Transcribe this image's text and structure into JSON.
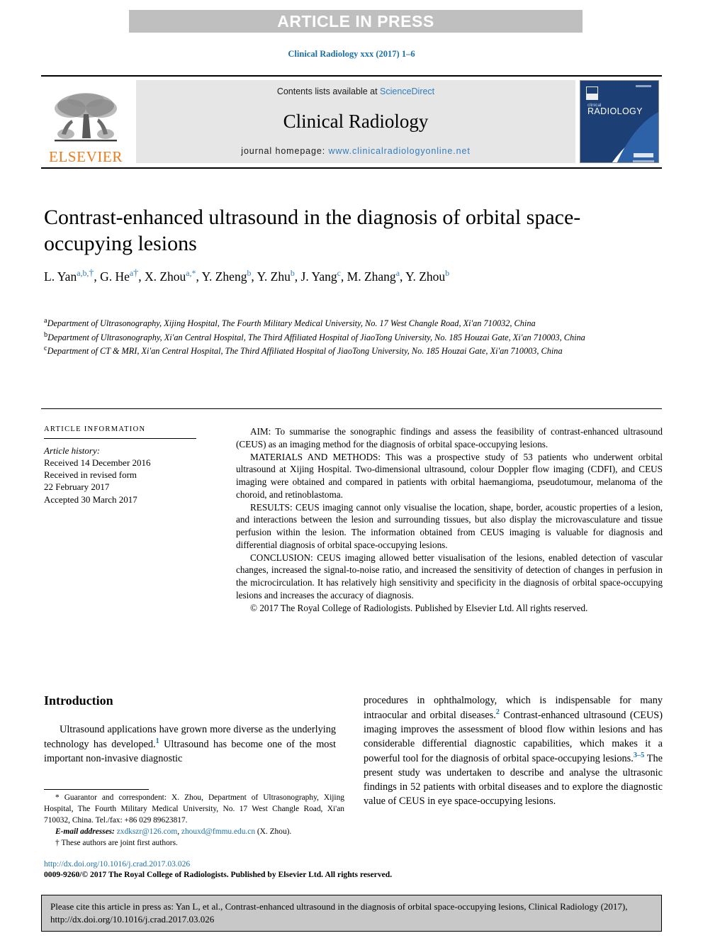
{
  "banner": {
    "text": "ARTICLE IN PRESS"
  },
  "journal_ref": "Clinical Radiology xxx (2017) 1–6",
  "masthead": {
    "publisher_name": "ELSEVIER",
    "contents_prefix": "Contents lists available at ",
    "contents_link": "ScienceDirect",
    "journal_title": "Clinical Radiology",
    "homepage_prefix": "journal homepage: ",
    "homepage_link": "www.clinicalradiologyonline.net",
    "cover_line1": "clinical",
    "cover_line2": "RADIOLOGY"
  },
  "article": {
    "title": "Contrast-enhanced ultrasound in the diagnosis of orbital space-occupying lesions",
    "authors": [
      {
        "name": "L. Yan",
        "sup": "a,b,",
        "dagger": true,
        "tail": ", "
      },
      {
        "name": "G. He",
        "sup": "a",
        "dagger": true,
        "tail": ", "
      },
      {
        "name": "X. Zhou",
        "sup": "a,",
        "star": true,
        "tail": ", "
      },
      {
        "name": "Y. Zheng",
        "sup": "b",
        "tail": ", "
      },
      {
        "name": "Y. Zhu",
        "sup": "b",
        "tail": ", "
      },
      {
        "name": "J. Yang",
        "sup": "c",
        "tail": ", "
      },
      {
        "name": "M. Zhang",
        "sup": "a",
        "tail": ", "
      },
      {
        "name": "Y. Zhou",
        "sup": "b",
        "tail": ""
      }
    ],
    "affiliations": [
      {
        "mark": "a",
        "text": "Department of Ultrasonography, Xijing Hospital, The Fourth Military Medical University, No. 17 West Changle Road, Xi'an 710032, China"
      },
      {
        "mark": "b",
        "text": "Department of Ultrasonography, Xi'an Central Hospital, The Third Affiliated Hospital of JiaoTong University, No. 185 Houzai Gate, Xi'an 710003, China"
      },
      {
        "mark": "c",
        "text": "Department of CT & MRI, Xi'an Central Hospital, The Third Affiliated Hospital of JiaoTong University, No. 185 Houzai Gate, Xi'an 710003, China"
      }
    ]
  },
  "article_info": {
    "heading": "ARTICLE INFORMATION",
    "history_label": "Article history:",
    "received": "Received 14 December 2016",
    "revised_label": "Received in revised form",
    "revised_date": "22 February 2017",
    "accepted": "Accepted 30 March 2017"
  },
  "abstract": {
    "aim": "AIM: To summarise the sonographic findings and assess the feasibility of contrast-enhanced ultrasound (CEUS) as an imaging method for the diagnosis of orbital space-occupying lesions.",
    "materials": "MATERIALS AND METHODS: This was a prospective study of 53 patients who underwent orbital ultrasound at Xijing Hospital. Two-dimensional ultrasound, colour Doppler flow imaging (CDFI), and CEUS imaging were obtained and compared in patients with orbital haemangioma, pseudotumour, melanoma of the choroid, and retinoblastoma.",
    "results": "RESULTS: CEUS imaging cannot only visualise the location, shape, border, acoustic properties of a lesion, and interactions between the lesion and surrounding tissues, but also display the microvasculature and tissue perfusion within the lesion. The information obtained from CEUS imaging is valuable for diagnosis and differential diagnosis of orbital space-occupying lesions.",
    "conclusion": "CONCLUSION: CEUS imaging allowed better visualisation of the lesions, enabled detection of vascular changes, increased the signal-to-noise ratio, and increased the sensitivity of detection of changes in perfusion in the microcirculation. It has relatively high sensitivity and specificity in the diagnosis of orbital space-occupying lesions and increases the accuracy of diagnosis.",
    "copyright": "© 2017 The Royal College of Radiologists. Published by Elsevier Ltd. All rights reserved."
  },
  "body": {
    "section_heading": "Introduction",
    "left_col_part1": "Ultrasound applications have grown more diverse as the underlying technology has developed.",
    "left_ref1": "1",
    "left_col_part2": " Ultrasound has become one of the most important non-invasive diagnostic",
    "right_col_part1": "procedures in ophthalmology, which is indispensable for many intraocular and orbital diseases.",
    "right_ref2": "2",
    "right_col_part2": " Contrast-enhanced ultrasound (CEUS) imaging improves the assessment of blood flow within lesions and has considerable differential diagnostic capabilities, which makes it a powerful tool for the diagnosis of orbital space-occupying lesions.",
    "right_ref35": "3–5",
    "right_col_part3": " The present study was undertaken to describe and analyse the ultrasonic findings in 52 patients with orbital diseases and to explore the diagnostic value of CEUS in eye space-occupying lesions."
  },
  "footnotes": {
    "star_symbol": "*",
    "correspondence": "Guarantor and correspondent: X. Zhou, Department of Ultrasonography, Xijing Hospital, The Fourth Military Medical University, No. 17 West Changle Road, Xi'an 710032, China. Tel./fax: +86 029 89623817.",
    "email_label": "E-mail addresses:",
    "email1": "zxdkszr@126.com",
    "email2": "zhouxd@fmmu.edu.cn",
    "email_tail": "(X. Zhou).",
    "dagger_symbol": "†",
    "joint_first": "These authors are joint first authors.",
    "doi_url": "http://dx.doi.org/10.1016/j.crad.2017.03.026",
    "issn_copyright": "0009-9260/© 2017 The Royal College of Radiologists. Published by Elsevier Ltd. All rights reserved."
  },
  "citation_footer": {
    "text": "Please cite this article in press as: Yan L, et al., Contrast-enhanced ultrasound in the diagnosis of orbital space-occupying lesions, Clinical Radiology (2017), http://dx.doi.org/10.1016/j.crad.2017.03.026"
  },
  "colors": {
    "link_blue": "#2f7dbe",
    "ref_blue": "#1b70a8",
    "elsevier_orange": "#ec7b1e",
    "banner_gray": "#bfbfbf",
    "panel_gray": "#e6e6e6",
    "footer_gray": "#c8c8c8"
  }
}
